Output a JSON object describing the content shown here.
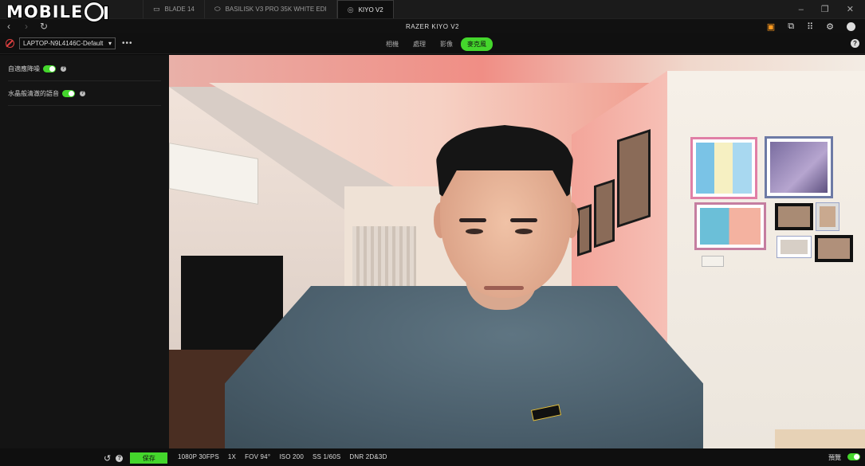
{
  "logo": {
    "text": "MOBILE"
  },
  "tabs": [
    {
      "label": "BLADE 14",
      "icon": "laptop-icon"
    },
    {
      "label": "BASILISK V3 PRO 35K WHITE EDI",
      "icon": "mouse-icon"
    },
    {
      "label": "KIYO V2",
      "icon": "webcam-icon",
      "active": true
    }
  ],
  "nav": {
    "back": "‹",
    "forward": "›",
    "refresh": "↻",
    "title": "RAZER KIYO V2"
  },
  "toolbar": {
    "profile": "LAPTOP-N9L4146C-Default",
    "more": "•••",
    "sections": [
      {
        "label": "相機",
        "active": false
      },
      {
        "label": "處理",
        "active": false
      },
      {
        "label": "影像",
        "active": false
      },
      {
        "label": "麥克風",
        "active": true
      }
    ]
  },
  "sidebar": {
    "settings": [
      {
        "label": "自適應降噪",
        "enabled": true
      },
      {
        "label": "水晶般清澈的語音",
        "enabled": true
      }
    ]
  },
  "bottom": {
    "save": "保存",
    "stats": [
      "1080P 30FPS",
      "1X",
      "FOV 94°",
      "ISO 200",
      "SS 1/60S",
      "DNR 2D&3D"
    ],
    "preview_label": "預覽",
    "preview_enabled": true
  },
  "colors": {
    "accent": "#44d62c",
    "alert": "#ff9a1f",
    "bg": "#0b0b0b"
  }
}
